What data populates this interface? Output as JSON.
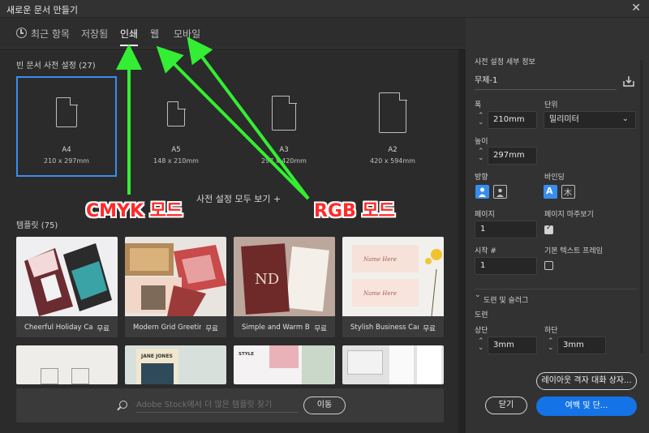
{
  "window": {
    "title": "새로운 문서 만들기",
    "close_glyph": "✕"
  },
  "tabs": [
    {
      "label": "최근 항목"
    },
    {
      "label": "저장됨"
    },
    {
      "label": "인쇄"
    },
    {
      "label": "웹"
    },
    {
      "label": "모바일"
    }
  ],
  "blank_presets": {
    "heading": "빈 문서 사전 설정",
    "count": "(27)",
    "items": [
      {
        "name": "A4",
        "size": "210 x 297mm"
      },
      {
        "name": "A5",
        "size": "148 x 210mm"
      },
      {
        "name": "A3",
        "size": "297 x 420mm"
      },
      {
        "name": "A2",
        "size": "420 x 594mm"
      }
    ],
    "view_all": "사전 설정 모두 보기 +"
  },
  "templates": {
    "heading": "템플릿",
    "count": "(75)",
    "items": [
      {
        "name": "Cheerful Holiday Car...",
        "price": "무료"
      },
      {
        "name": "Modern Grid Greetin...",
        "price": "무료"
      },
      {
        "name": "Simple and Warm Bu...",
        "price": "무료"
      },
      {
        "name": "Stylish Business Card...",
        "price": "무료"
      }
    ],
    "thumb_texts": {
      "name_here": "Name Here",
      "nd": "ND",
      "jane_jones": "JANE JONES",
      "style": "STYLE"
    }
  },
  "search": {
    "placeholder": "Adobe Stock에서 더 많은 템플릿 찾기",
    "button": "이동"
  },
  "details": {
    "heading": "사전 설정 세부 정보",
    "doc_name": "무제-1",
    "width_label": "폭",
    "width_value": "210mm",
    "unit_label": "단위",
    "unit_value": "밀리미터",
    "height_label": "높이",
    "height_value": "297mm",
    "orientation_label": "방향",
    "binding_label": "바인딩",
    "pages_label": "페이지",
    "pages_value": "1",
    "facing_label": "페이지 마주보기",
    "facing_checked": true,
    "start_label": "시작 #",
    "start_value": "1",
    "primary_frame_label": "기본 텍스트 프레임",
    "primary_frame_checked": false,
    "bleed_section": "도련 및 슬러그",
    "bleed_label": "도련",
    "top_label": "상단",
    "top_value": "3mm",
    "bottom_label": "하단",
    "bottom_value": "3mm",
    "layout_grid_button": "레이아웃 격자 대화 상자...",
    "close_button": "닫기",
    "margins_button": "여백 및 단..."
  },
  "annotations": {
    "cmyk": "CMYK 모드",
    "rgb": "RGB 모드",
    "arrow_color": "#33ee33",
    "label_color": "#ff2a2a"
  },
  "colors": {
    "accent": "#378ef0",
    "primary_button": "#1473e6"
  }
}
